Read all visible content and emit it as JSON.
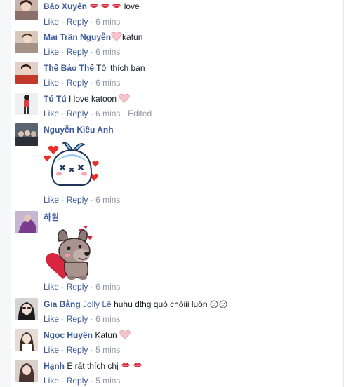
{
  "actions": {
    "like": "Like",
    "reply": "Reply",
    "separator": "·",
    "edited": "Edited"
  },
  "comments": [
    {
      "author": "Bảo Xuyên",
      "text": "love",
      "time": "6 mins"
    },
    {
      "author": "Mai Trần Nguyễn",
      "text": "katun",
      "time": "6 mins"
    },
    {
      "author": "Thế Bảo Thế",
      "text": "Tôi thích bạn",
      "time": "6 mins"
    },
    {
      "author": "Tú Tú",
      "text": "I love katoon",
      "time": "6 mins"
    },
    {
      "author": "Nguyễn Kiều Anh",
      "text": "",
      "time": "6 mins",
      "sticker": "whale-hearts-sticker"
    },
    {
      "author": "하원",
      "text": "",
      "time": "6 mins",
      "sticker": "dog-heart-sticker"
    },
    {
      "author": "Gia Bằng",
      "tagged": "Jolly Lê",
      "text": "huhu dthg quó chòiii luôn",
      "time": "6 mins"
    },
    {
      "author": "Ngọc Huyền",
      "text": "Katun",
      "time": "5 mins"
    },
    {
      "author": "Hạnh",
      "text": "E rất thích chị",
      "time": "5 mins"
    }
  ],
  "colors": {
    "link": "#3b5998",
    "meta": "#9197a3",
    "text": "#141823",
    "heart": "#e9a5ad",
    "lips": "#d7263d"
  }
}
